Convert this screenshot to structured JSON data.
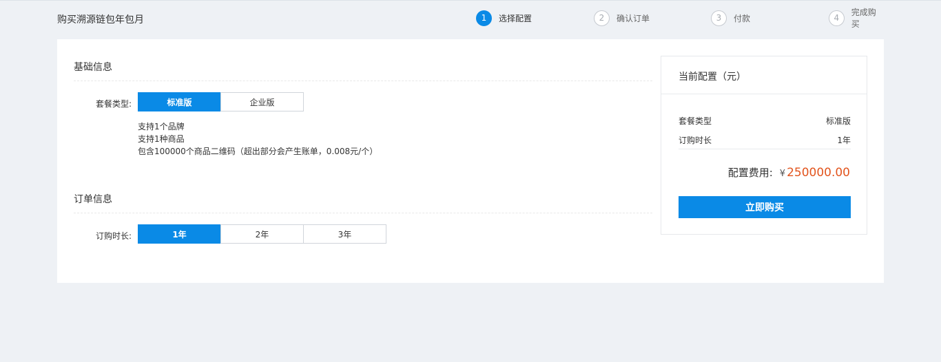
{
  "header": {
    "title": "购买溯源链包年包月",
    "steps": [
      {
        "num": "1",
        "label": "选择配置",
        "active": true
      },
      {
        "num": "2",
        "label": "确认订单",
        "active": false
      },
      {
        "num": "3",
        "label": "付款",
        "active": false
      },
      {
        "num": "4",
        "label": "完成购买",
        "active": false
      }
    ]
  },
  "basic": {
    "title": "基础信息",
    "package_label": "套餐类型:",
    "package_options": [
      "标准版",
      "企业版"
    ],
    "package_selected": "标准版",
    "features": [
      "支持1个品牌",
      "支持1种商品",
      "包含100000个商品二维码（超出部分会产生账单，0.008元/个）"
    ]
  },
  "order": {
    "title": "订单信息",
    "duration_label": "订购时长:",
    "duration_options": [
      "1年",
      "2年",
      "3年"
    ],
    "duration_selected": "1年"
  },
  "summary": {
    "title": "当前配置（元）",
    "rows": [
      {
        "label": "套餐类型",
        "value": "标准版"
      },
      {
        "label": "订购时长",
        "value": "1年"
      }
    ],
    "fee_label": "配置费用:",
    "currency": "¥",
    "fee_value": "250000.00",
    "buy_label": "立即购买"
  },
  "colors": {
    "accent": "#0a8ae6",
    "price": "#e2541d",
    "background": "#eef1f5"
  }
}
